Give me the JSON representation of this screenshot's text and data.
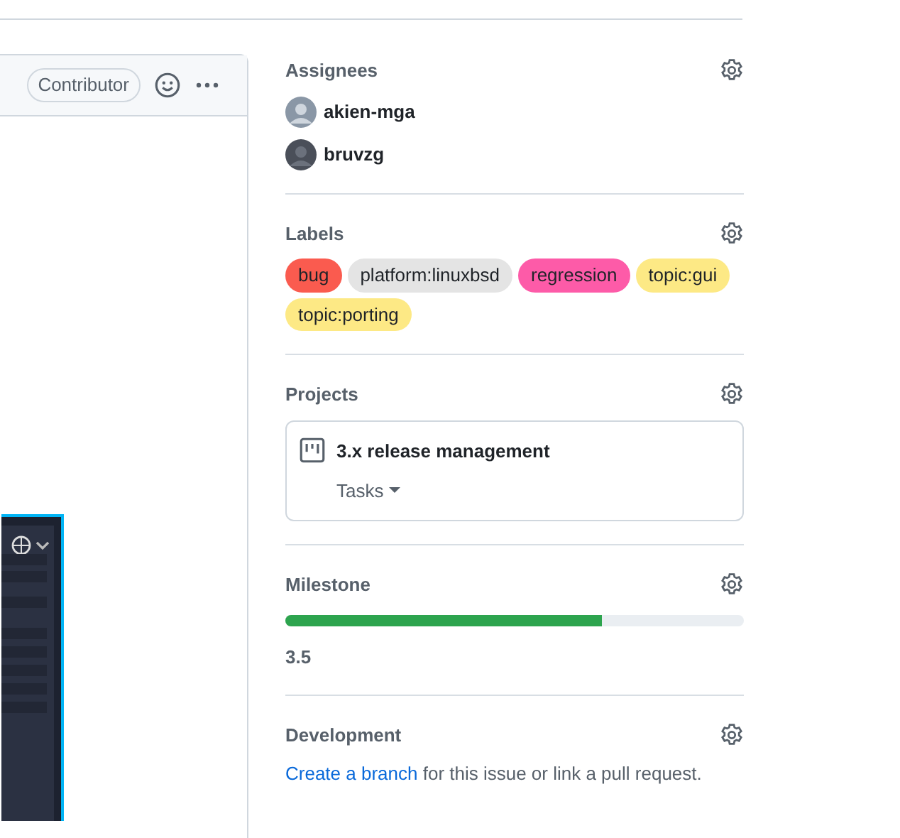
{
  "comment": {
    "badge": "Contributor"
  },
  "sidebar": {
    "assignees": {
      "title": "Assignees",
      "people": [
        {
          "login": "akien-mga"
        },
        {
          "login": "bruvzg"
        }
      ]
    },
    "labels": {
      "title": "Labels",
      "items": [
        {
          "name": "bug",
          "color": "#fa5b4f"
        },
        {
          "name": "platform:linuxbsd",
          "color": "#e4e4e4"
        },
        {
          "name": "regression",
          "color": "#fd5ba8"
        },
        {
          "name": "topic:gui",
          "color": "#fde985"
        },
        {
          "name": "topic:porting",
          "color": "#fde985"
        }
      ]
    },
    "projects": {
      "title": "Projects",
      "items": [
        {
          "name": "3.x release management",
          "column": "Tasks"
        }
      ]
    },
    "milestone": {
      "title": "Milestone",
      "level": 0.69,
      "name": "3.5"
    },
    "development": {
      "title": "Development",
      "link": "Create a branch",
      "text": " for this issue or link a pull request."
    }
  }
}
